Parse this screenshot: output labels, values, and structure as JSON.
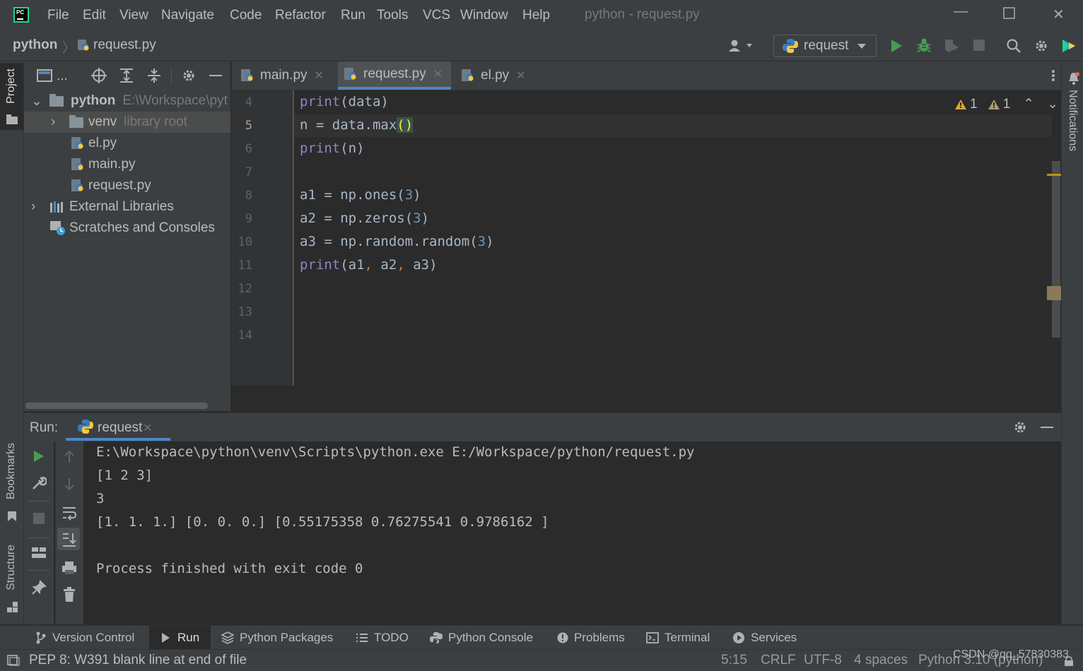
{
  "menu": {
    "items": [
      "File",
      "Edit",
      "View",
      "Navigate",
      "Code",
      "Refactor",
      "Run",
      "Tools",
      "VCS",
      "Window",
      "Help"
    ],
    "window_title": "python - request.py",
    "logo_text": "PC"
  },
  "navbar": {
    "project": "python",
    "separator": "〉",
    "file": "request.py",
    "run_config": "request"
  },
  "project_panel": {
    "toolbar_ellipsis": "...",
    "tree": [
      {
        "label": "python",
        "suffix": "E:\\Workspace\\pyt"
      },
      {
        "label": "venv",
        "suffix": "library root"
      },
      {
        "label": "el.py"
      },
      {
        "label": "main.py"
      },
      {
        "label": "request.py"
      },
      {
        "label": "External Libraries"
      },
      {
        "label": "Scratches and Consoles"
      }
    ]
  },
  "tool_stripe": {
    "left": [
      "Project",
      "Bookmarks",
      "Structure"
    ],
    "right": [
      "Notifications"
    ]
  },
  "tabs": [
    "main.py",
    "request.py",
    "el.py"
  ],
  "inspection": {
    "warnings_a": "1",
    "warnings_b": "1"
  },
  "editor": {
    "line_numbers": [
      "4",
      "5",
      "6",
      "7",
      "8",
      "9",
      "10",
      "11",
      "12",
      "13",
      "14"
    ],
    "lines": {
      "l4": {
        "fn": "print",
        "rest": "(data)"
      },
      "l5": {
        "text": "n = data.max",
        "brace": "()"
      },
      "l6": {
        "fn": "print",
        "rest": "(n)"
      },
      "l8": {
        "pre": "a1 = np.ones(",
        "num": "3",
        "post": ")"
      },
      "l9": {
        "pre": "a2 = np.zeros(",
        "num": "3",
        "post": ")"
      },
      "l10": {
        "pre": "a3 = np.random.random(",
        "num": "3",
        "post": ")"
      },
      "l11": {
        "fn": "print",
        "a": "(a1",
        "c": ",",
        "b": " a2",
        "c2": ",",
        "d": " a3)"
      }
    }
  },
  "run": {
    "label": "Run:",
    "tab": "request",
    "output": [
      "E:\\Workspace\\python\\venv\\Scripts\\python.exe E:/Workspace/python/request.py",
      "[1 2 3]",
      "3",
      "[1. 1. 1.] [0. 0. 0.] [0.55175358 0.76275541 0.9786162 ]",
      "",
      "Process finished with exit code 0"
    ]
  },
  "bottom_tools": [
    "Version Control",
    "Run",
    "Python Packages",
    "TODO",
    "Python Console",
    "Problems",
    "Terminal",
    "Services"
  ],
  "status": {
    "message": "PEP 8: W391 blank line at end of file",
    "position": "5:15",
    "line_sep": "CRLF",
    "encoding": "UTF-8",
    "indent": "4 spaces",
    "interpreter": "Python 3.10 (python)",
    "watermark": "CSDN @qq_57830383"
  },
  "colors": {
    "accent": "#4a88c7",
    "run_green": "#499c54",
    "warning": "#e0a52e",
    "background": "#2b2b2b",
    "panel": "#3c3f41"
  }
}
